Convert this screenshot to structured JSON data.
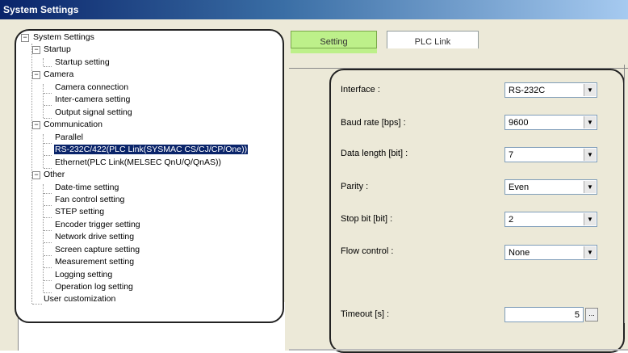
{
  "window": {
    "title": "System Settings"
  },
  "tree": {
    "items": [
      {
        "label": "System Settings"
      },
      {
        "label": "Startup"
      },
      {
        "label": "Startup setting"
      },
      {
        "label": "Camera"
      },
      {
        "label": "Camera connection"
      },
      {
        "label": "Inter-camera setting"
      },
      {
        "label": "Output signal setting"
      },
      {
        "label": "Communication"
      },
      {
        "label": "Parallel"
      },
      {
        "label": "RS-232C/422(PLC Link(SYSMAC CS/CJ/CP/One))"
      },
      {
        "label": "Ethernet(PLC Link(MELSEC QnU/Q/QnAS))"
      },
      {
        "label": "Other"
      },
      {
        "label": "Date-time setting"
      },
      {
        "label": "Fan control setting"
      },
      {
        "label": "STEP setting"
      },
      {
        "label": "Encoder trigger setting"
      },
      {
        "label": "Network drive setting"
      },
      {
        "label": "Screen capture setting"
      },
      {
        "label": "Measurement setting"
      },
      {
        "label": "Logging setting"
      },
      {
        "label": "Operation log setting"
      },
      {
        "label": "User customization"
      }
    ],
    "expander_symbol": "−"
  },
  "tabs": [
    {
      "label": "Setting"
    },
    {
      "label": "PLC Link"
    }
  ],
  "form": {
    "interface": {
      "label": "Interface :",
      "value": "RS-232C"
    },
    "baud_rate": {
      "label": "Baud rate [bps] :",
      "value": "9600"
    },
    "data_length": {
      "label": "Data length [bit] :",
      "value": "7"
    },
    "parity": {
      "label": "Parity :",
      "value": "Even"
    },
    "stop_bit": {
      "label": "Stop bit [bit] :",
      "value": "2"
    },
    "flow_control": {
      "label": "Flow control :",
      "value": "None"
    },
    "timeout": {
      "label": "Timeout [s] :",
      "value": "5",
      "button": "..."
    },
    "dropdown_arrow": "▼"
  },
  "colors": {
    "selected_bg": "#0a246a",
    "active_tab": "#bdf08a",
    "titlebar": "#0a246a"
  }
}
